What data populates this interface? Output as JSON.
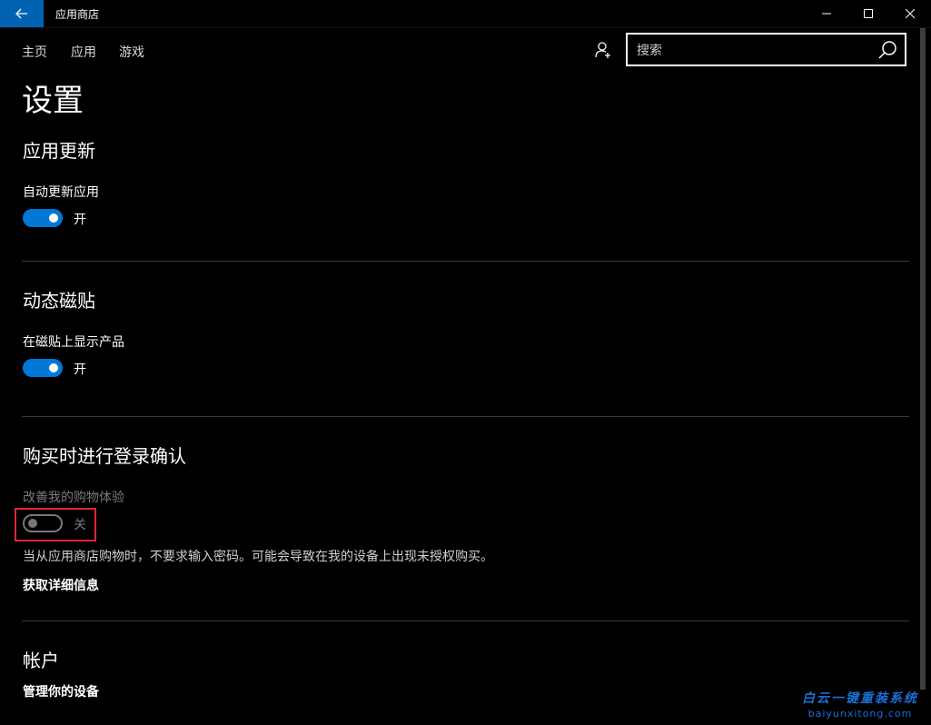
{
  "window": {
    "title": "应用商店"
  },
  "nav": {
    "items": [
      "主页",
      "应用",
      "游戏"
    ]
  },
  "search": {
    "placeholder": "搜索"
  },
  "page": {
    "title": "设置"
  },
  "sections": {
    "app_updates": {
      "title": "应用更新",
      "label": "自动更新应用",
      "toggle_on": true,
      "state": "开"
    },
    "live_tiles": {
      "title": "动态磁贴",
      "label": "在磁贴上显示产品",
      "toggle_on": true,
      "state": "开"
    },
    "purchase_signin": {
      "title": "购买时进行登录确认",
      "label": "改善我的购物体验",
      "toggle_on": false,
      "state": "关",
      "description": "当从应用商店购物时，不要求输入密码。可能会导致在我的设备上出现未授权购买。",
      "link": "获取详细信息"
    },
    "account": {
      "title": "帐户",
      "link": "管理你的设备"
    }
  },
  "watermark": {
    "title": "白云一键重装系统",
    "url": "baiyunxitong.com"
  },
  "colors": {
    "accent": "#0078d7",
    "back_button": "#0063b1",
    "highlight_box": "#e0262c",
    "watermark": "#1a6fd6"
  },
  "icons": [
    "back-arrow-icon",
    "minimize-icon",
    "maximize-icon",
    "close-icon",
    "account-add-icon",
    "search-icon"
  ]
}
